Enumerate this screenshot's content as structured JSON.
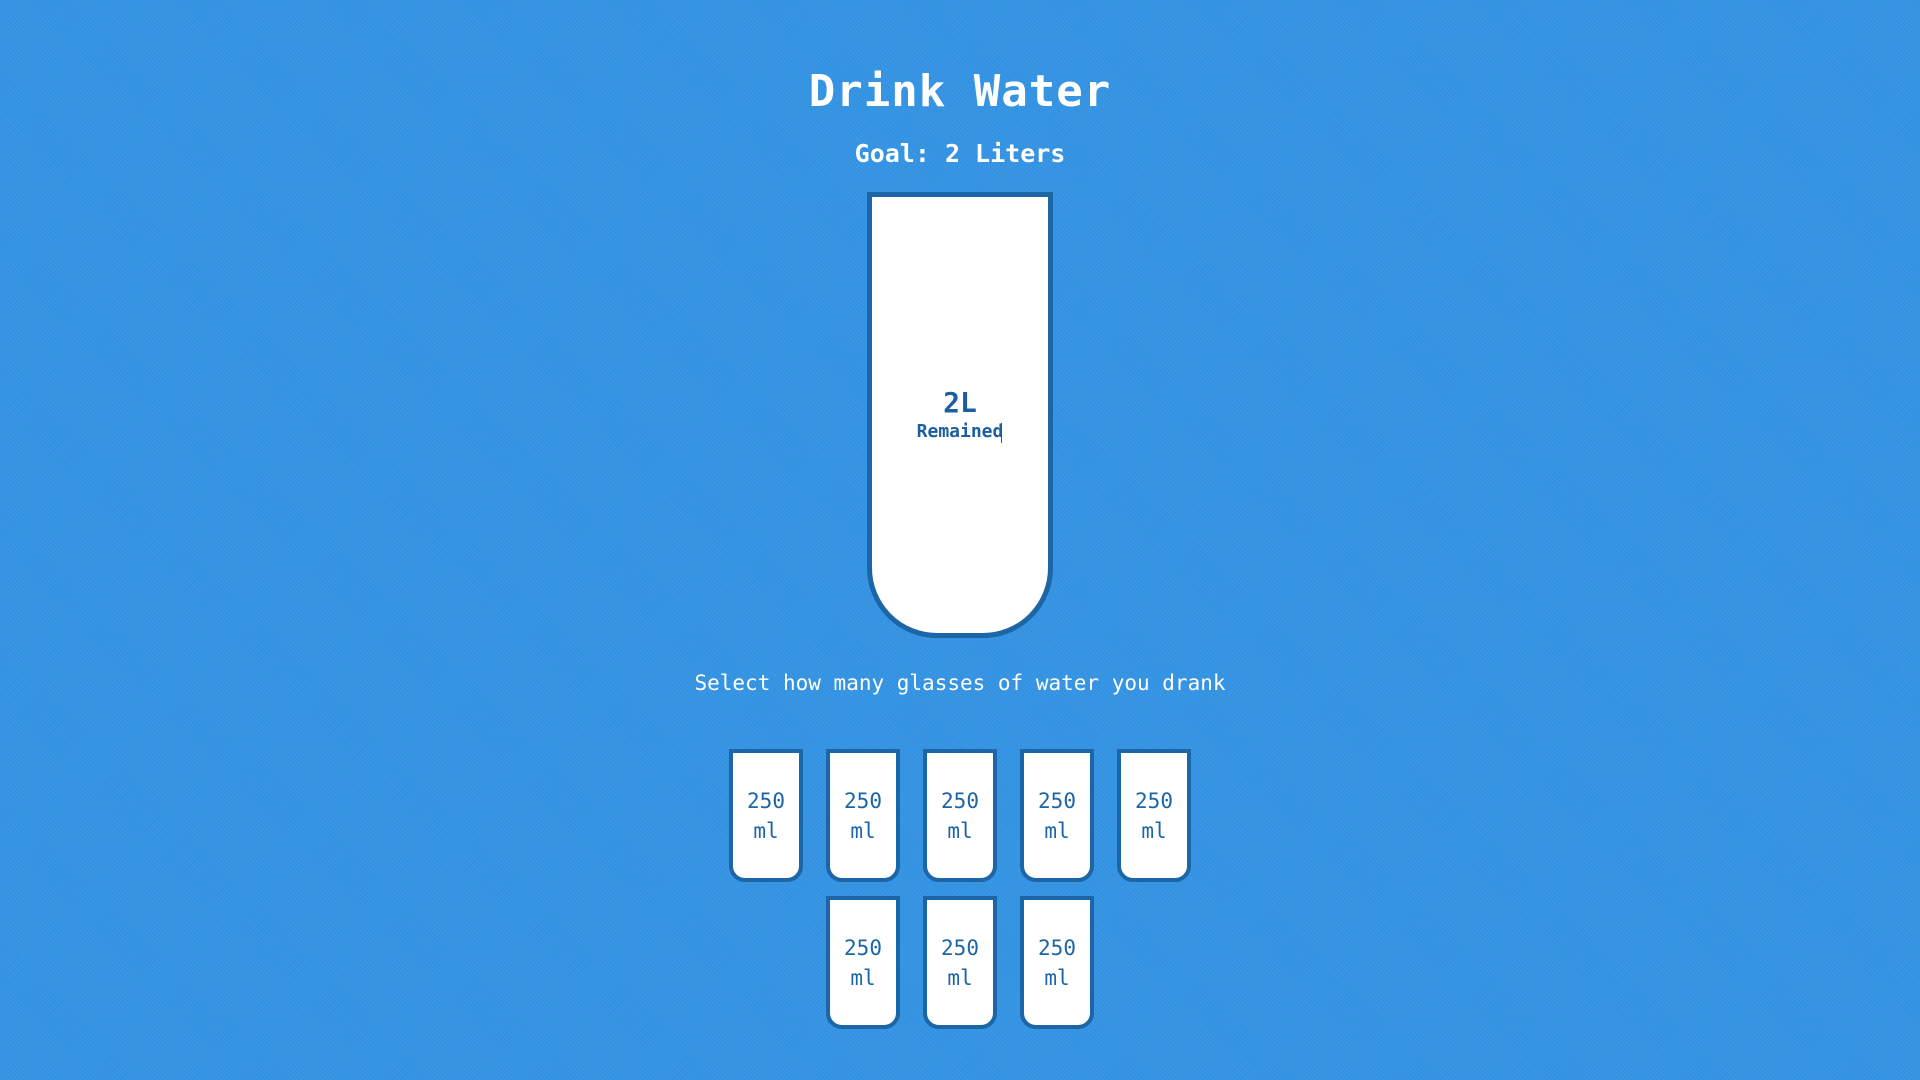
{
  "app": {
    "title": "Drink Water",
    "goal_text": "Goal: 2 Liters"
  },
  "big_cup": {
    "remained_liters": "2L",
    "remained_label": "Remained",
    "filled_fraction": 0
  },
  "instruction": "Select how many glasses of water you drank",
  "cups": [
    {
      "amount": "250",
      "unit": "ml",
      "full": false
    },
    {
      "amount": "250",
      "unit": "ml",
      "full": false
    },
    {
      "amount": "250",
      "unit": "ml",
      "full": false
    },
    {
      "amount": "250",
      "unit": "ml",
      "full": false
    },
    {
      "amount": "250",
      "unit": "ml",
      "full": false
    },
    {
      "amount": "250",
      "unit": "ml",
      "full": false
    },
    {
      "amount": "250",
      "unit": "ml",
      "full": false
    },
    {
      "amount": "250",
      "unit": "ml",
      "full": false
    }
  ],
  "colors": {
    "background": "#3494e4",
    "cup_border": "#1c65a6",
    "cup_fill": "#ffffff",
    "text_light": "#ffffff"
  }
}
